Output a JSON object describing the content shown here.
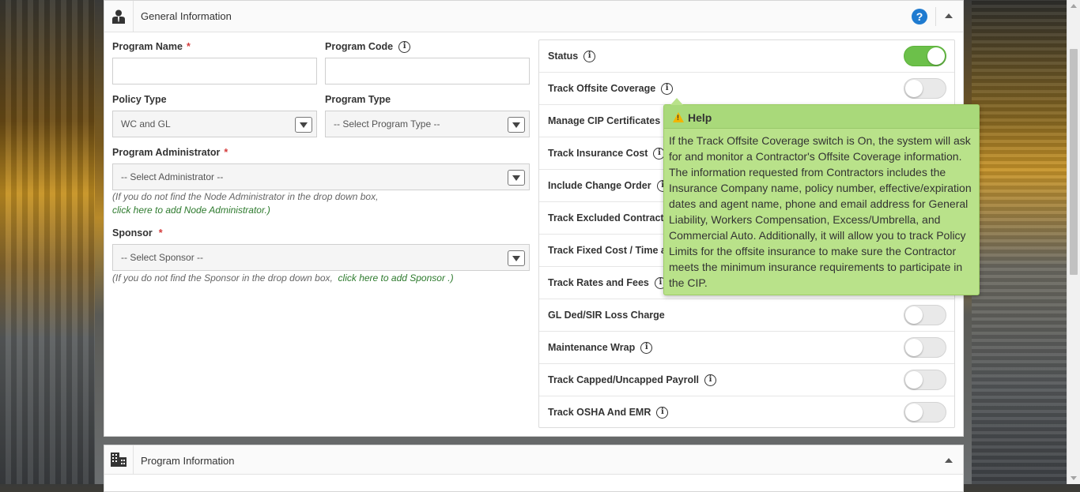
{
  "general": {
    "title": "General Information",
    "help_icon": "question-circle-icon",
    "collapse_icon": "caret-up-icon"
  },
  "form": {
    "program_name": {
      "label": "Program Name",
      "required": "*",
      "value": ""
    },
    "program_code": {
      "label": "Program Code",
      "value": ""
    },
    "policy_type": {
      "label": "Policy Type",
      "value": "WC and GL"
    },
    "program_type": {
      "label": "Program Type",
      "value": "-- Select Program Type --"
    },
    "program_admin": {
      "label": "Program Administrator",
      "required": "*",
      "value": "-- Select Administrator --",
      "hint": "(If you do not find the Node Administrator in the drop down box,",
      "link": "click here to add Node Administrator.)"
    },
    "sponsor": {
      "label": "Sponsor",
      "required": "*",
      "value": "-- Select Sponsor --",
      "hint": "(If you do not find the Sponsor in the drop down box,",
      "link": "click here to add Sponsor .)"
    }
  },
  "settings": [
    {
      "label": "Status",
      "on": true
    },
    {
      "label": "Track Offsite Coverage",
      "on": false
    },
    {
      "label": "Manage CIP Certificates",
      "on": false
    },
    {
      "label": "Track Insurance Cost",
      "on": false
    },
    {
      "label": "Include Change Order",
      "on": false
    },
    {
      "label": "Track Excluded Contracto",
      "on": false
    },
    {
      "label": "Track Fixed Cost / Time a",
      "on": false
    },
    {
      "label": "Track Rates and Fees",
      "on": false
    },
    {
      "label": "GL Ded/SIR Loss Charge",
      "on": false
    },
    {
      "label": "Maintenance Wrap",
      "on": false
    },
    {
      "label": "Track Capped/Uncapped Payroll",
      "on": false
    },
    {
      "label": "Track OSHA And EMR",
      "on": false
    }
  ],
  "tooltip": {
    "title": "Help",
    "body": "If the Track Offsite Coverage switch is On, the system will ask for and monitor a Contractor's Offsite Coverage information. The information requested from Contractors includes the Insurance Company name, policy number, effective/expiration dates and agent name, phone and email address for General Liability, Workers Compensation, Excess/Umbrella, and Commercial Auto. Additionally, it will allow you to track Policy Limits for the offsite insurance to make sure the Contractor meets the minimum insurance requirements to participate in the CIP."
  },
  "program_panel": {
    "title": "Program Information"
  },
  "colors": {
    "toggle_on": "#6cc04a",
    "help_blue": "#1f7bd0",
    "tooltip_bg": "#b9e28a",
    "link_green": "#2d7a2d",
    "required_red": "#d43b3b"
  }
}
